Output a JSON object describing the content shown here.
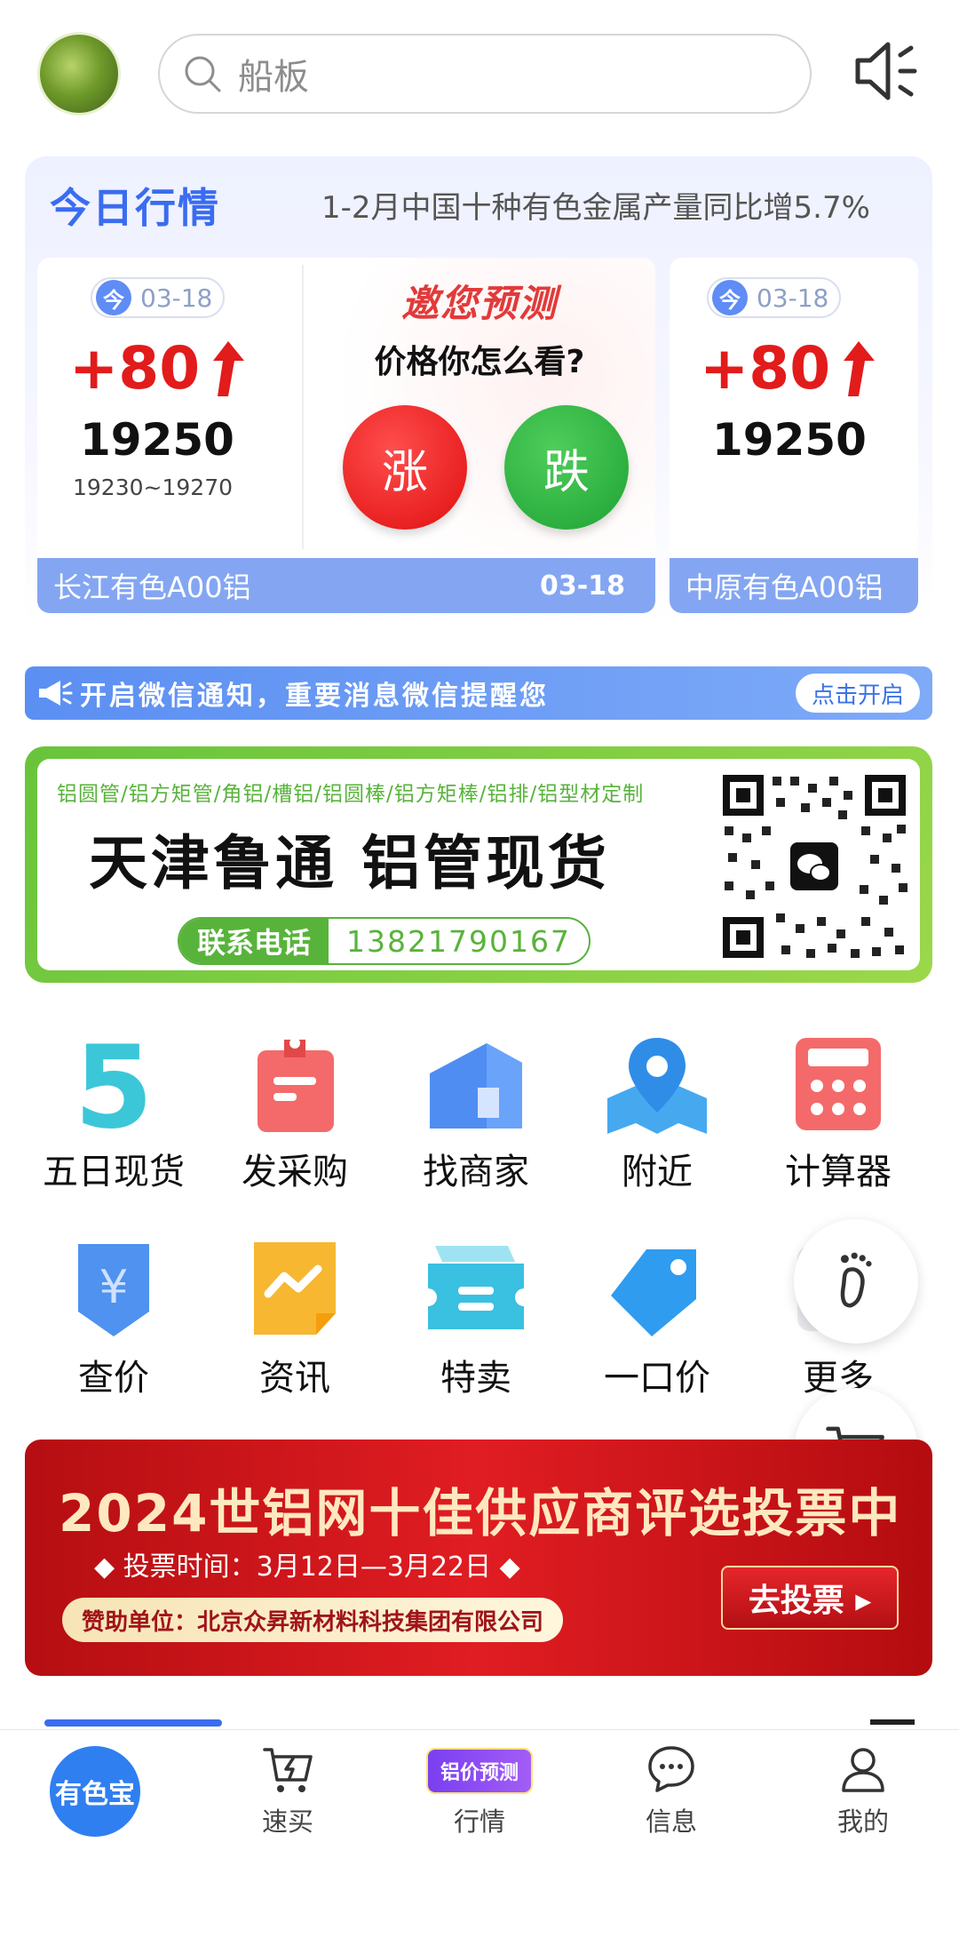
{
  "header": {
    "search_placeholder": "船板"
  },
  "market": {
    "title": "今日行情",
    "news": "1-2月中国十种有色金属产量同比增5.7%",
    "cards": [
      {
        "today_badge": "今",
        "date": "03-18",
        "change": "+80",
        "price": "19250",
        "range": "19230~19270",
        "name": "长江有色A00铝",
        "footer_date": "03-18"
      },
      {
        "today_badge": "今",
        "date": "03-18",
        "change": "+80",
        "price": "19250",
        "name": "中原有色A00铝"
      }
    ],
    "predict": {
      "title": "邀您预测",
      "question": "价格你怎么看?",
      "up_label": "涨",
      "down_label": "跌"
    }
  },
  "notify": {
    "text": "开启微信通知，重要消息微信提醒您",
    "button": "点击开启"
  },
  "ad": {
    "small": "铝圆管/铝方矩管/角铝/槽铝/铝圆棒/铝方矩棒/铝排/铝型材定制",
    "big": "天津鲁通 铝管现货",
    "phone_label": "联系电话",
    "phone": "13821790167"
  },
  "grid": [
    {
      "label": "五日现货",
      "icon": "five-icon",
      "glyph": "5"
    },
    {
      "label": "发采购",
      "icon": "clipboard-icon"
    },
    {
      "label": "找商家",
      "icon": "shop-icon"
    },
    {
      "label": "附近",
      "icon": "map-pin-icon"
    },
    {
      "label": "计算器",
      "icon": "calculator-icon"
    },
    {
      "label": "查价",
      "icon": "yuan-shield-icon",
      "glyph": "¥"
    },
    {
      "label": "资讯",
      "icon": "news-icon"
    },
    {
      "label": "特卖",
      "icon": "ticket-icon"
    },
    {
      "label": "一口价",
      "icon": "tag-icon"
    },
    {
      "label": "更多",
      "icon": "more-icon"
    }
  ],
  "vote": {
    "title": "2024世铝网十佳供应商评选投票中",
    "time": "◆ 投票时间：3月12日—3月22日 ◆",
    "sponsor": "赞助单位：北京众昇新材料科技集团有限公司",
    "button": "去投票 ▸"
  },
  "tabbar": {
    "home": "有色宝",
    "items": [
      {
        "label": "速买",
        "icon": "quick-buy-cart-icon"
      },
      {
        "label": "行情",
        "icon": "price-forecast-badge",
        "badge": "铝价预测"
      },
      {
        "label": "信息",
        "icon": "chat-bubble-icon"
      },
      {
        "label": "我的",
        "icon": "user-icon"
      }
    ]
  },
  "colors": {
    "accent": "#3a6cf0",
    "up_red": "#e21b1b",
    "down_green": "#1ea334",
    "ad_green": "#58b33b",
    "vote_red": "#d0161b"
  }
}
